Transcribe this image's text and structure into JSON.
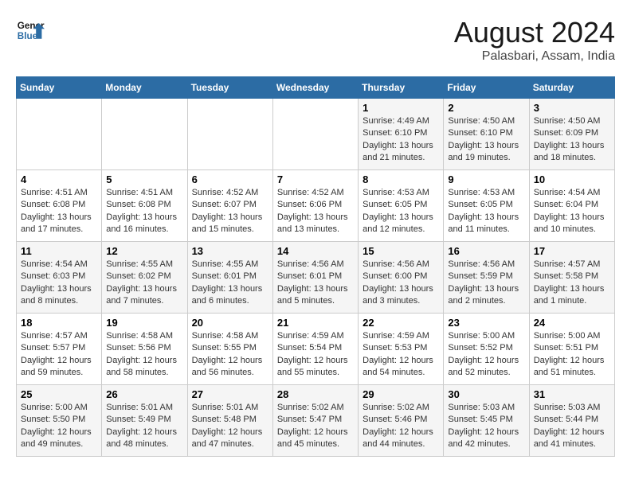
{
  "header": {
    "logo_general": "General",
    "logo_blue": "Blue",
    "month": "August 2024",
    "location": "Palasbari, Assam, India"
  },
  "days_of_week": [
    "Sunday",
    "Monday",
    "Tuesday",
    "Wednesday",
    "Thursday",
    "Friday",
    "Saturday"
  ],
  "weeks": [
    [
      {
        "day": "",
        "content": ""
      },
      {
        "day": "",
        "content": ""
      },
      {
        "day": "",
        "content": ""
      },
      {
        "day": "",
        "content": ""
      },
      {
        "day": "1",
        "content": "Sunrise: 4:49 AM\nSunset: 6:10 PM\nDaylight: 13 hours\nand 21 minutes."
      },
      {
        "day": "2",
        "content": "Sunrise: 4:50 AM\nSunset: 6:10 PM\nDaylight: 13 hours\nand 19 minutes."
      },
      {
        "day": "3",
        "content": "Sunrise: 4:50 AM\nSunset: 6:09 PM\nDaylight: 13 hours\nand 18 minutes."
      }
    ],
    [
      {
        "day": "4",
        "content": "Sunrise: 4:51 AM\nSunset: 6:08 PM\nDaylight: 13 hours\nand 17 minutes."
      },
      {
        "day": "5",
        "content": "Sunrise: 4:51 AM\nSunset: 6:08 PM\nDaylight: 13 hours\nand 16 minutes."
      },
      {
        "day": "6",
        "content": "Sunrise: 4:52 AM\nSunset: 6:07 PM\nDaylight: 13 hours\nand 15 minutes."
      },
      {
        "day": "7",
        "content": "Sunrise: 4:52 AM\nSunset: 6:06 PM\nDaylight: 13 hours\nand 13 minutes."
      },
      {
        "day": "8",
        "content": "Sunrise: 4:53 AM\nSunset: 6:05 PM\nDaylight: 13 hours\nand 12 minutes."
      },
      {
        "day": "9",
        "content": "Sunrise: 4:53 AM\nSunset: 6:05 PM\nDaylight: 13 hours\nand 11 minutes."
      },
      {
        "day": "10",
        "content": "Sunrise: 4:54 AM\nSunset: 6:04 PM\nDaylight: 13 hours\nand 10 minutes."
      }
    ],
    [
      {
        "day": "11",
        "content": "Sunrise: 4:54 AM\nSunset: 6:03 PM\nDaylight: 13 hours\nand 8 minutes."
      },
      {
        "day": "12",
        "content": "Sunrise: 4:55 AM\nSunset: 6:02 PM\nDaylight: 13 hours\nand 7 minutes."
      },
      {
        "day": "13",
        "content": "Sunrise: 4:55 AM\nSunset: 6:01 PM\nDaylight: 13 hours\nand 6 minutes."
      },
      {
        "day": "14",
        "content": "Sunrise: 4:56 AM\nSunset: 6:01 PM\nDaylight: 13 hours\nand 5 minutes."
      },
      {
        "day": "15",
        "content": "Sunrise: 4:56 AM\nSunset: 6:00 PM\nDaylight: 13 hours\nand 3 minutes."
      },
      {
        "day": "16",
        "content": "Sunrise: 4:56 AM\nSunset: 5:59 PM\nDaylight: 13 hours\nand 2 minutes."
      },
      {
        "day": "17",
        "content": "Sunrise: 4:57 AM\nSunset: 5:58 PM\nDaylight: 13 hours\nand 1 minute."
      }
    ],
    [
      {
        "day": "18",
        "content": "Sunrise: 4:57 AM\nSunset: 5:57 PM\nDaylight: 12 hours\nand 59 minutes."
      },
      {
        "day": "19",
        "content": "Sunrise: 4:58 AM\nSunset: 5:56 PM\nDaylight: 12 hours\nand 58 minutes."
      },
      {
        "day": "20",
        "content": "Sunrise: 4:58 AM\nSunset: 5:55 PM\nDaylight: 12 hours\nand 56 minutes."
      },
      {
        "day": "21",
        "content": "Sunrise: 4:59 AM\nSunset: 5:54 PM\nDaylight: 12 hours\nand 55 minutes."
      },
      {
        "day": "22",
        "content": "Sunrise: 4:59 AM\nSunset: 5:53 PM\nDaylight: 12 hours\nand 54 minutes."
      },
      {
        "day": "23",
        "content": "Sunrise: 5:00 AM\nSunset: 5:52 PM\nDaylight: 12 hours\nand 52 minutes."
      },
      {
        "day": "24",
        "content": "Sunrise: 5:00 AM\nSunset: 5:51 PM\nDaylight: 12 hours\nand 51 minutes."
      }
    ],
    [
      {
        "day": "25",
        "content": "Sunrise: 5:00 AM\nSunset: 5:50 PM\nDaylight: 12 hours\nand 49 minutes."
      },
      {
        "day": "26",
        "content": "Sunrise: 5:01 AM\nSunset: 5:49 PM\nDaylight: 12 hours\nand 48 minutes."
      },
      {
        "day": "27",
        "content": "Sunrise: 5:01 AM\nSunset: 5:48 PM\nDaylight: 12 hours\nand 47 minutes."
      },
      {
        "day": "28",
        "content": "Sunrise: 5:02 AM\nSunset: 5:47 PM\nDaylight: 12 hours\nand 45 minutes."
      },
      {
        "day": "29",
        "content": "Sunrise: 5:02 AM\nSunset: 5:46 PM\nDaylight: 12 hours\nand 44 minutes."
      },
      {
        "day": "30",
        "content": "Sunrise: 5:03 AM\nSunset: 5:45 PM\nDaylight: 12 hours\nand 42 minutes."
      },
      {
        "day": "31",
        "content": "Sunrise: 5:03 AM\nSunset: 5:44 PM\nDaylight: 12 hours\nand 41 minutes."
      }
    ]
  ]
}
